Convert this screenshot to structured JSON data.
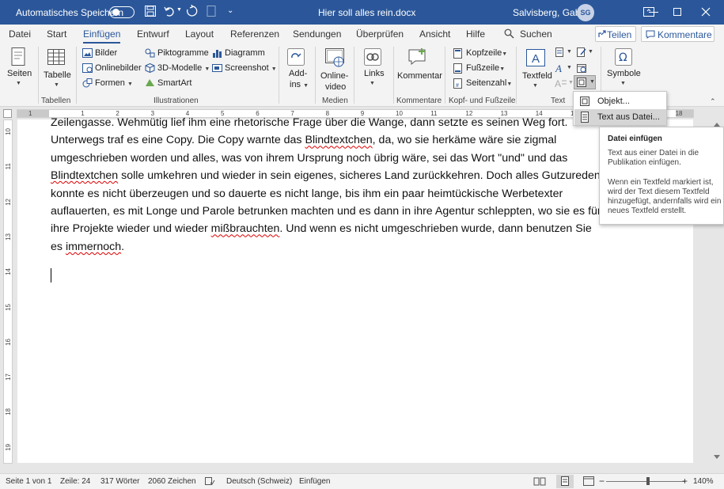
{
  "titlebar": {
    "autosave_label": "Automatisches Speichern",
    "autosave_state": "off",
    "doc_title": "Hier soll alles rein.docx",
    "user_name": "Salvisberg, Gaby",
    "user_initials": "SG"
  },
  "tabs": {
    "items": [
      "Datei",
      "Start",
      "Einfügen",
      "Entwurf",
      "Layout",
      "Referenzen",
      "Sendungen",
      "Überprüfen",
      "Ansicht",
      "Hilfe"
    ],
    "active": "Einfügen",
    "search": "Suchen",
    "share": "Teilen",
    "comments": "Kommentare"
  },
  "ribbon": {
    "seiten": "Seiten",
    "tabelle": "Tabelle",
    "bilder": "Bilder",
    "onlinebilder": "Onlinebilder",
    "formen": "Formen",
    "piktogramme": "Piktogramme",
    "modelle_3d": "3D-Modelle",
    "smartart": "SmartArt",
    "diagramm": "Diagramm",
    "screenshot": "Screenshot",
    "addins_1": "Add-",
    "addins_2": "ins",
    "onlinevideo_1": "Online-",
    "onlinevideo_2": "video",
    "links": "Links",
    "kommentar": "Kommentar",
    "kopfzeile": "Kopfzeile",
    "fusszeile": "Fußzeile",
    "seitenzahl": "Seitenzahl",
    "textfeld": "Textfeld",
    "symbole": "Symbole",
    "groups": {
      "tabellen": "Tabellen",
      "illustrationen": "Illustrationen",
      "medien": "Medien",
      "kommentare": "Kommentare",
      "kopf_fuss": "Kopf- und Fußzeile",
      "text": "Text"
    }
  },
  "ruler": {
    "h_numbers": [
      "1",
      "1",
      "2",
      "3",
      "4",
      "5",
      "6",
      "7",
      "8",
      "9",
      "10",
      "11",
      "12",
      "13",
      "14",
      "15",
      "16",
      "17",
      "18"
    ],
    "v_numbers": [
      "10",
      "11",
      "12",
      "13",
      "14",
      "15",
      "16",
      "17",
      "18",
      "19"
    ]
  },
  "document": {
    "segments": [
      {
        "text": "Zeilengasse. Wehmütig lief ihm eine rhetorische Frage über die Wange, dann setzte es seinen Weg fort. Unterwegs traf es eine Copy. Die Copy warnte das ",
        "err": false
      },
      {
        "text": "Blindtextchen",
        "err": true
      },
      {
        "text": ", da, wo sie herkäme wäre sie zigmal umgeschrieben worden und alles, was von ihrem Ursprung noch übrig wäre, sei das Wort \"und\" und das ",
        "err": false
      },
      {
        "text": "Blindtextchen",
        "err": true
      },
      {
        "text": " solle umkehren und wieder in sein eigenes, sicheres Land zurückkehren. Doch alles Gutzureden konnte es nicht überzeugen und so dauerte es nicht lange, bis ihm ein paar heimtückische Werbetexter auflauerten, es mit Longe und Parole betrunken machten und es dann in ihre Agentur schleppten, wo sie es für ihre Projekte wieder und wieder ",
        "err": false
      },
      {
        "text": "mißbrauchten",
        "err": true
      },
      {
        "text": ". Und wenn es nicht umgeschrieben wurde, dann benutzen Sie es ",
        "err": false
      },
      {
        "text": "immernoch",
        "err": true
      },
      {
        "text": ".",
        "err": false
      }
    ]
  },
  "menu": {
    "item1": "Objekt...",
    "item2": "Text aus Datei..."
  },
  "tooltip": {
    "title": "Datei einfügen",
    "p1": "Text aus einer Datei in die Publikation einfügen.",
    "p2": "Wenn ein Textfeld markiert ist, wird der Text diesem Textfeld hinzugefügt, andernfalls wird ein neues Textfeld erstellt."
  },
  "status": {
    "page": "Seite 1 von 1",
    "line": "Zeile: 24",
    "words": "317 Wörter",
    "chars": "2060 Zeichen",
    "language": "Deutsch (Schweiz)",
    "mode": "Einfügen",
    "zoom": "140%"
  },
  "colors": {
    "accent": "#2b579a",
    "spell_error": "#d00000"
  }
}
